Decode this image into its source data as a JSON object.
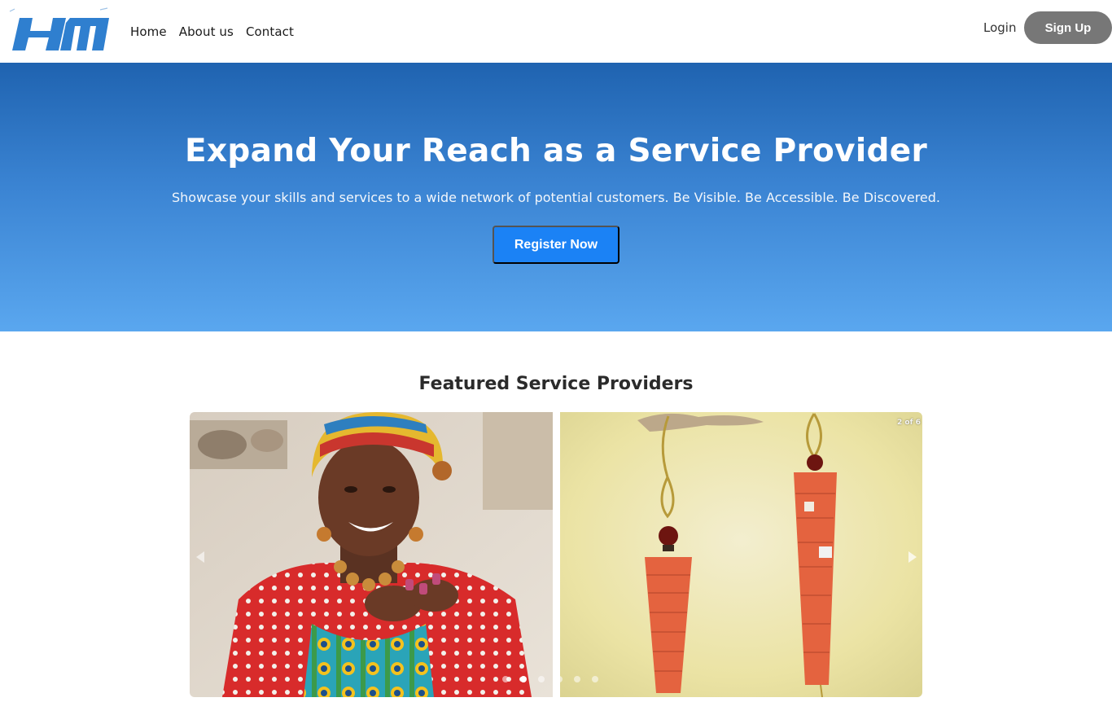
{
  "brand": {
    "logo_text": "HM",
    "logo_color": "#2f7fcf"
  },
  "nav": {
    "links": [
      "Home",
      "About us",
      "Contact"
    ],
    "login": "Login",
    "signup": "Sign Up"
  },
  "hero": {
    "title": "Expand Your Reach as a Service Provider",
    "subtitle": "Showcase your skills and services to a wide network of potential customers. Be Visible. Be Accessible. Be Discovered.",
    "cta": "Register Now",
    "cta_color": "#1b82f5"
  },
  "featured": {
    "title": "Featured Service Providers",
    "counter": "2 of 6",
    "slides": [
      "artisan-with-bead-necklace",
      "paper-bead-earrings"
    ],
    "dot_count": 6,
    "active_dot": 2
  }
}
